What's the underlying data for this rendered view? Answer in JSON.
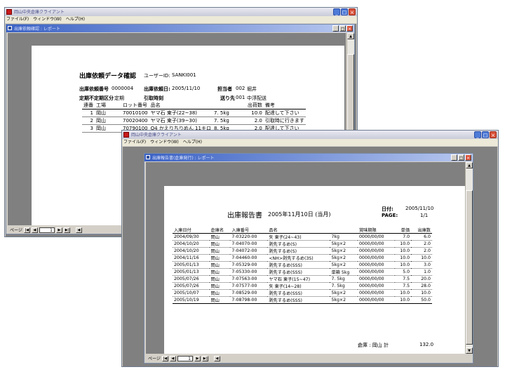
{
  "back_window": {
    "title": "岡山中央倉庫クライアント",
    "menu": [
      "ファイル(F)",
      "ウィンドウ(W)",
      "ヘルプ(H)"
    ],
    "child_title": "出庫依頼確認 : レポート",
    "report": {
      "title": "出庫依頼データ確認",
      "user_label": "ユーザーID:",
      "user_value": "SANKI001",
      "req_no_label": "出庫依頼番号",
      "req_no_value": "0000004",
      "req_date_label": "出庫依頼日:",
      "req_date_value": "2005/11/10",
      "staff_label": "担当者",
      "staff_code": "002",
      "staff_name": "堀井",
      "kubun_label": "定期不定期区分",
      "kubun_value": "定期",
      "pickup_label": "引取時刻",
      "dest_label": "送り先",
      "dest_code": "001",
      "dest_name": "中浮配送",
      "columns": [
        "連番",
        "工場",
        "ロット番号",
        "品名",
        "出荷数",
        "備考"
      ],
      "rows": [
        {
          "no": "1",
          "factory": "岡山",
          "lot": "70010100",
          "item": "ヤマ石 東子(22~38)",
          "weight": "7. 5kg",
          "qty": "10.0",
          "note": "配達して下さい"
        },
        {
          "no": "2",
          "factory": "岡山",
          "lot": "70020400",
          "item": "ヤマ石 東子(39~30)",
          "weight": "7. 5kg",
          "qty": "2.0",
          "note": "引取時に行きます"
        },
        {
          "no": "3",
          "factory": "岡山",
          "lot": "70790100",
          "item": "O4 かえりちりめん 11キロ",
          "weight": "8. 5kg",
          "qty": "2.0",
          "note": "配達して下さい"
        }
      ]
    },
    "pager": {
      "label": "ページ",
      "first": "|◀",
      "prev": "◀",
      "page": "1",
      "next": "▶",
      "last": "▶|"
    }
  },
  "front_window": {
    "title": "岡山中央倉庫クライアント",
    "menu": [
      "ファイル(F)",
      "ウィンドウ(W)",
      "ヘルプ(H)"
    ],
    "child_title": "出庫報告書(倉庫発行) : レポート",
    "report": {
      "title": "出庫報告書",
      "date_text": "2005年11月10日 (当月)",
      "date_label": "日付:",
      "date_value": "2005/11/10",
      "page_label": "PAGE:",
      "page_value": "1/1",
      "columns": [
        "入庫日付",
        "倉庫名",
        "入庫番号",
        "品名",
        "",
        "賞味期限",
        "単価",
        "出庫数"
      ],
      "rows": [
        {
          "date": "2004/09/30",
          "wh": "岡山",
          "no": "7-03220-00",
          "item": "矢 東子(24~43)",
          "spec": "7kg",
          "exp": "0000/00/00",
          "price": "7.0",
          "qty": "6.0"
        },
        {
          "date": "2004/10/20",
          "wh": "岡山",
          "no": "7-04070-00",
          "item": "剥先するめ(S)",
          "spec": "5kg×2",
          "exp": "0000/00/00",
          "price": "10.0",
          "qty": "2.0"
        },
        {
          "date": "2004/10/20",
          "wh": "岡山",
          "no": "7-04072-00",
          "item": "剥先するめ(S)",
          "spec": "5kg×2",
          "exp": "0000/00/00",
          "price": "10.0",
          "qty": "2.0"
        },
        {
          "date": "2004/11/16",
          "wh": "岡山",
          "no": "7-04460-00",
          "item": "<NH>剥先するめ(3S)",
          "spec": "5kg×2",
          "exp": "0000/00/00",
          "price": "10.0",
          "qty": "10.0"
        },
        {
          "date": "2005/01/13",
          "wh": "岡山",
          "no": "7-05329-00",
          "item": "剥先するめ(SSS)",
          "spec": "5kg×2",
          "exp": "0000/00/00",
          "price": "10.0",
          "qty": "3.0"
        },
        {
          "date": "2005/01/13",
          "wh": "岡山",
          "no": "7-05330-00",
          "item": "剥先するめ(SSS)",
          "spec": "単箱 5kg",
          "exp": "0000/00/00",
          "price": "5.0",
          "qty": "1.0"
        },
        {
          "date": "2005/07/26",
          "wh": "岡山",
          "no": "7-07563-00",
          "item": "ヤマ石 東子(15~47)",
          "spec": "7. 5kg",
          "exp": "0000/00/00",
          "price": "7.5",
          "qty": "20.0"
        },
        {
          "date": "2005/07/26",
          "wh": "岡山",
          "no": "7-07577-00",
          "item": "矢 東子(14~28)",
          "spec": "7. 5kg",
          "exp": "0000/00/00",
          "price": "7.5",
          "qty": "28.0"
        },
        {
          "date": "2005/10/07",
          "wh": "岡山",
          "no": "7-08529-00",
          "item": "剥先するめ(SSS)",
          "spec": "5kg×2",
          "exp": "0000/00/00",
          "price": "10.0",
          "qty": "10.0"
        },
        {
          "date": "2005/10/19",
          "wh": "岡山",
          "no": "7-08798-00",
          "item": "剥先するめ(SSS)",
          "spec": "5kg×2",
          "exp": "0000/00/00",
          "price": "10.0",
          "qty": "50.0"
        }
      ],
      "total_label": "倉庫 : 岡山 計",
      "total_value": "132.0"
    },
    "pager": {
      "label": "ページ",
      "first": "|◀",
      "prev": "◀",
      "page": "1",
      "next": "▶",
      "last": "▶|"
    }
  },
  "buttons": {
    "min": "_",
    "max": "□",
    "close": "×"
  },
  "colors": {
    "title_gradient_start": "#3b62c4",
    "close_red": "#d9533c",
    "canvas_gray": "#808080"
  }
}
